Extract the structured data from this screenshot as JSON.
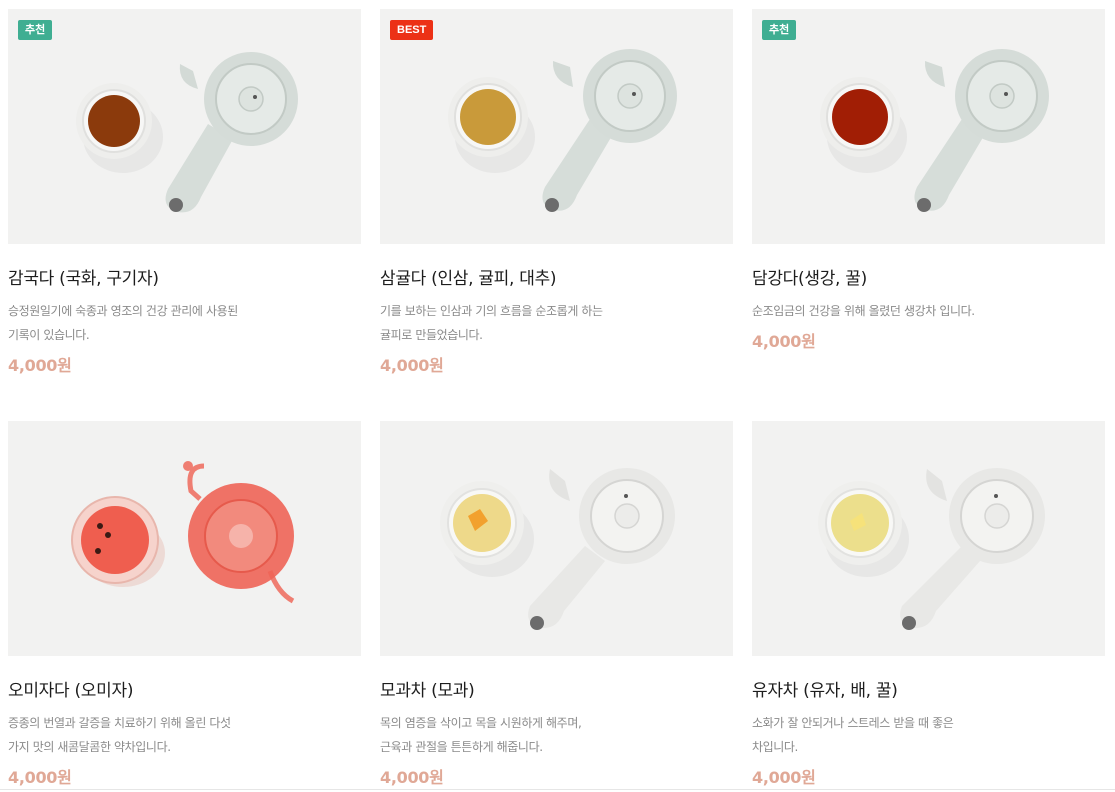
{
  "products": [
    {
      "badge": "추천",
      "badge_color": "#3fae92",
      "name": "감국다 (국화, 구기자)",
      "description": "승정원일기에 숙종과 영조의 건강 관리에 사용된 기록이 있습니다.",
      "price": "4,000원",
      "tea_color": "#8b3a0c",
      "image_icon": "teapot-and-cup"
    },
    {
      "badge": "BEST",
      "badge_color": "#ec3116",
      "name": "삼귤다 (인삼, 귤피, 대추)",
      "description": "기를 보하는 인삼과 기의 흐름을 순조롭게 하는 귤피로 만들었습니다.",
      "price": "4,000원",
      "tea_color": "#c99a3a",
      "image_icon": "teapot-and-cup"
    },
    {
      "badge": "추천",
      "badge_color": "#3fae92",
      "name": "담강다(생강, 꿀)",
      "description": "순조임금의 건강을 위해 올렸던 생강차 입니다.",
      "price": "4,000원",
      "tea_color": "#a11e05",
      "image_icon": "teapot-and-cup"
    },
    {
      "badge": "",
      "badge_color": "",
      "name": "오미자다 (오미자)",
      "description": "증종의 번열과 갈증을 치료하기 위해 올린 다섯 가지 맛의 새콤달콤한 약차입니다.",
      "price": "4,000원",
      "tea_color": "#ef5e4f",
      "image_icon": "glass-teapot-and-cup"
    },
    {
      "badge": "",
      "badge_color": "",
      "name": "모과차 (모과)",
      "description": "목의 염증을 삭이고 목을 시원하게 해주며, 근육과 관절을 튼튼하게 해줍니다.",
      "price": "4,000원",
      "tea_color": "#eed98a",
      "image_icon": "teapot-and-cup"
    },
    {
      "badge": "",
      "badge_color": "",
      "name": "유자차 (유자, 배, 꿀)",
      "description": "소화가 잘 안되거나 스트레스 받을 때 좋은 차입니다.",
      "price": "4,000원",
      "tea_color": "#ecdf8c",
      "image_icon": "teapot-and-cup"
    }
  ]
}
